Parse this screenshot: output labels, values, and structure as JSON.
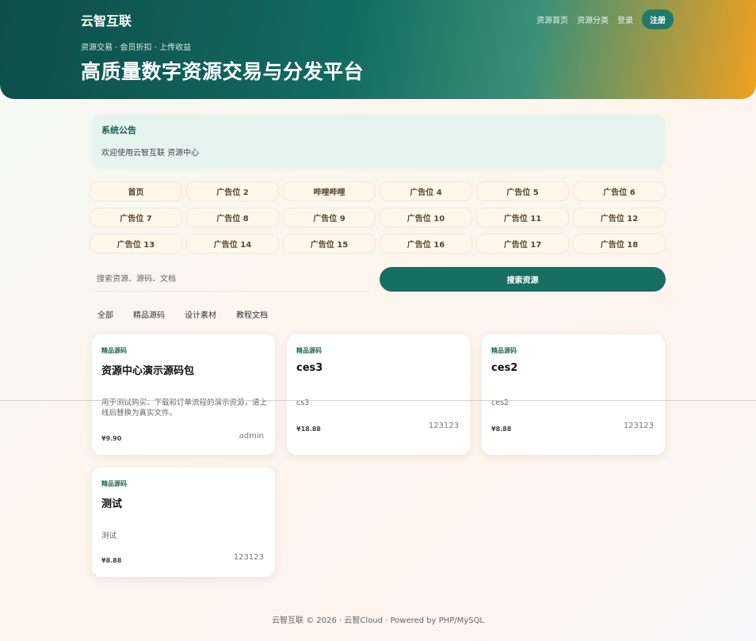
{
  "header": {
    "brand": "云智互联",
    "nav": [
      "资源首页",
      "资源分类",
      "登录"
    ],
    "register": "注册",
    "tagline": "资源交易 · 会员折扣 · 上传收益",
    "title": "高质量数字资源交易与分发平台"
  },
  "notice": {
    "title": "系统公告",
    "text": "欢迎使用云智互联 资源中心"
  },
  "ads": [
    "首页",
    "广告位 2",
    "哔哩哔哩",
    "广告位 4",
    "广告位 5",
    "广告位 6",
    "广告位 7",
    "广告位 8",
    "广告位 9",
    "广告位 10",
    "广告位 11",
    "广告位 12",
    "广告位 13",
    "广告位 14",
    "广告位 15",
    "广告位 16",
    "广告位 17",
    "广告位 18"
  ],
  "search": {
    "placeholder": "搜索资源、源码、文档",
    "button": "搜索资源"
  },
  "categories": [
    "全部",
    "精品源码",
    "设计素材",
    "教程文档"
  ],
  "cards": [
    {
      "tag": "精品源码",
      "title": "资源中心演示源码包",
      "desc": "用于测试购买、下载和订单流程的演示资源，请上线后替换为真实文件。",
      "price": "¥9.90",
      "author": "admin"
    },
    {
      "tag": "精品源码",
      "title": "ces3",
      "desc": "cs3",
      "price": "¥18.88",
      "author": "123123"
    },
    {
      "tag": "精品源码",
      "title": "ces2",
      "desc": "ces2",
      "price": "¥8.88",
      "author": "123123"
    },
    {
      "tag": "精品源码",
      "title": "测试",
      "desc": "测试",
      "price": "¥8.88",
      "author": "123123"
    }
  ],
  "footer": "云智互联 © 2026 · 云智Cloud · Powered by PHP/MySQL"
}
